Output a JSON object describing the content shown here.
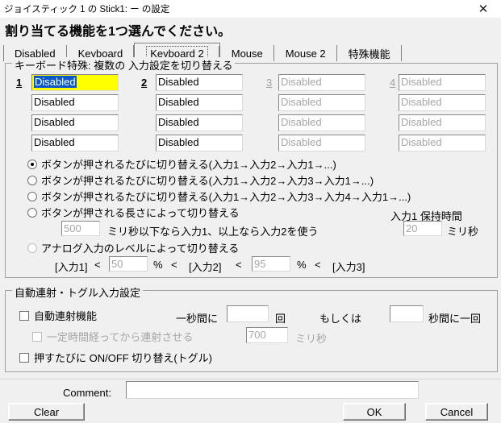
{
  "window": {
    "title": "ジョイスティック 1 の Stick1: ー の設定",
    "close_icon": "✕"
  },
  "heading": "割り当てる機能を1つ選んでください。",
  "tabs": [
    {
      "label": "Disabled",
      "selected": false
    },
    {
      "label": "Keyboard",
      "selected": false
    },
    {
      "label": "Keyboard 2",
      "selected": true
    },
    {
      "label": "Mouse",
      "selected": false
    },
    {
      "label": "Mouse 2",
      "selected": false
    },
    {
      "label": "特殊機能",
      "selected": false
    }
  ],
  "keyboard_group": {
    "title": "キーボード特殊: 複数の 入力設定を切り替える",
    "columns": [
      {
        "number": "1",
        "enabled": true,
        "fields": [
          "Disabled",
          "Disabled",
          "Disabled",
          "Disabled"
        ]
      },
      {
        "number": "2",
        "enabled": true,
        "fields": [
          "Disabled",
          "Disabled",
          "Disabled",
          "Disabled"
        ]
      },
      {
        "number": "3",
        "enabled": false,
        "fields": [
          "Disabled",
          "Disabled",
          "Disabled",
          "Disabled"
        ]
      },
      {
        "number": "4",
        "enabled": false,
        "fields": [
          "Disabled",
          "Disabled",
          "Disabled",
          "Disabled"
        ]
      }
    ],
    "modes": [
      {
        "label": "ボタンが押されるたびに切り替える(入力1→入力2→入力1→...)",
        "selected": true
      },
      {
        "label": "ボタンが押されるたびに切り替える(入力1→入力2→入力3→入力1→...)",
        "selected": false
      },
      {
        "label": "ボタンが押されるたびに切り替える(入力1→入力2→入力3→入力4→入力1→...)",
        "selected": false
      },
      {
        "label": "ボタンが押される長さによって切り替える",
        "selected": false
      },
      {
        "label": "アナログ入力のレベルによって切り替える",
        "selected": false
      }
    ],
    "duration": {
      "threshold_value": "500",
      "threshold_label": "ミリ秒以下なら入力1、以上なら入力2を使う",
      "hold_title": "入力1 保持時間",
      "hold_value": "20",
      "hold_unit": "ミリ秒"
    },
    "analog": {
      "input1_label": "[入力1]",
      "lt1": "<",
      "value1": "50",
      "pct1": "%",
      "lt2": "<",
      "input2_label": "[入力2]",
      "lt3": "<",
      "value2": "95",
      "pct2": "%",
      "lt4": "<",
      "input3_label": "[入力3]"
    }
  },
  "autofire_group": {
    "title": "自動連射・トグル入力設定",
    "autofire_checkbox": "自動連射機能",
    "per_second_label": "一秒間に",
    "per_second_value": "",
    "times_unit": "回",
    "or_label": "もしくは",
    "interval_value": "",
    "interval_unit": "秒間に一回",
    "delay_checkbox": "一定時間経ってから連射させる",
    "delay_value": "700",
    "delay_unit": "ミリ秒",
    "toggle_checkbox": "押すたびに ON/OFF 切り替え(トグル)"
  },
  "footer": {
    "comment_label": "Comment:",
    "comment_value": "",
    "clear_label": "Clear",
    "ok_label": "OK",
    "cancel_label": "Cancel"
  }
}
